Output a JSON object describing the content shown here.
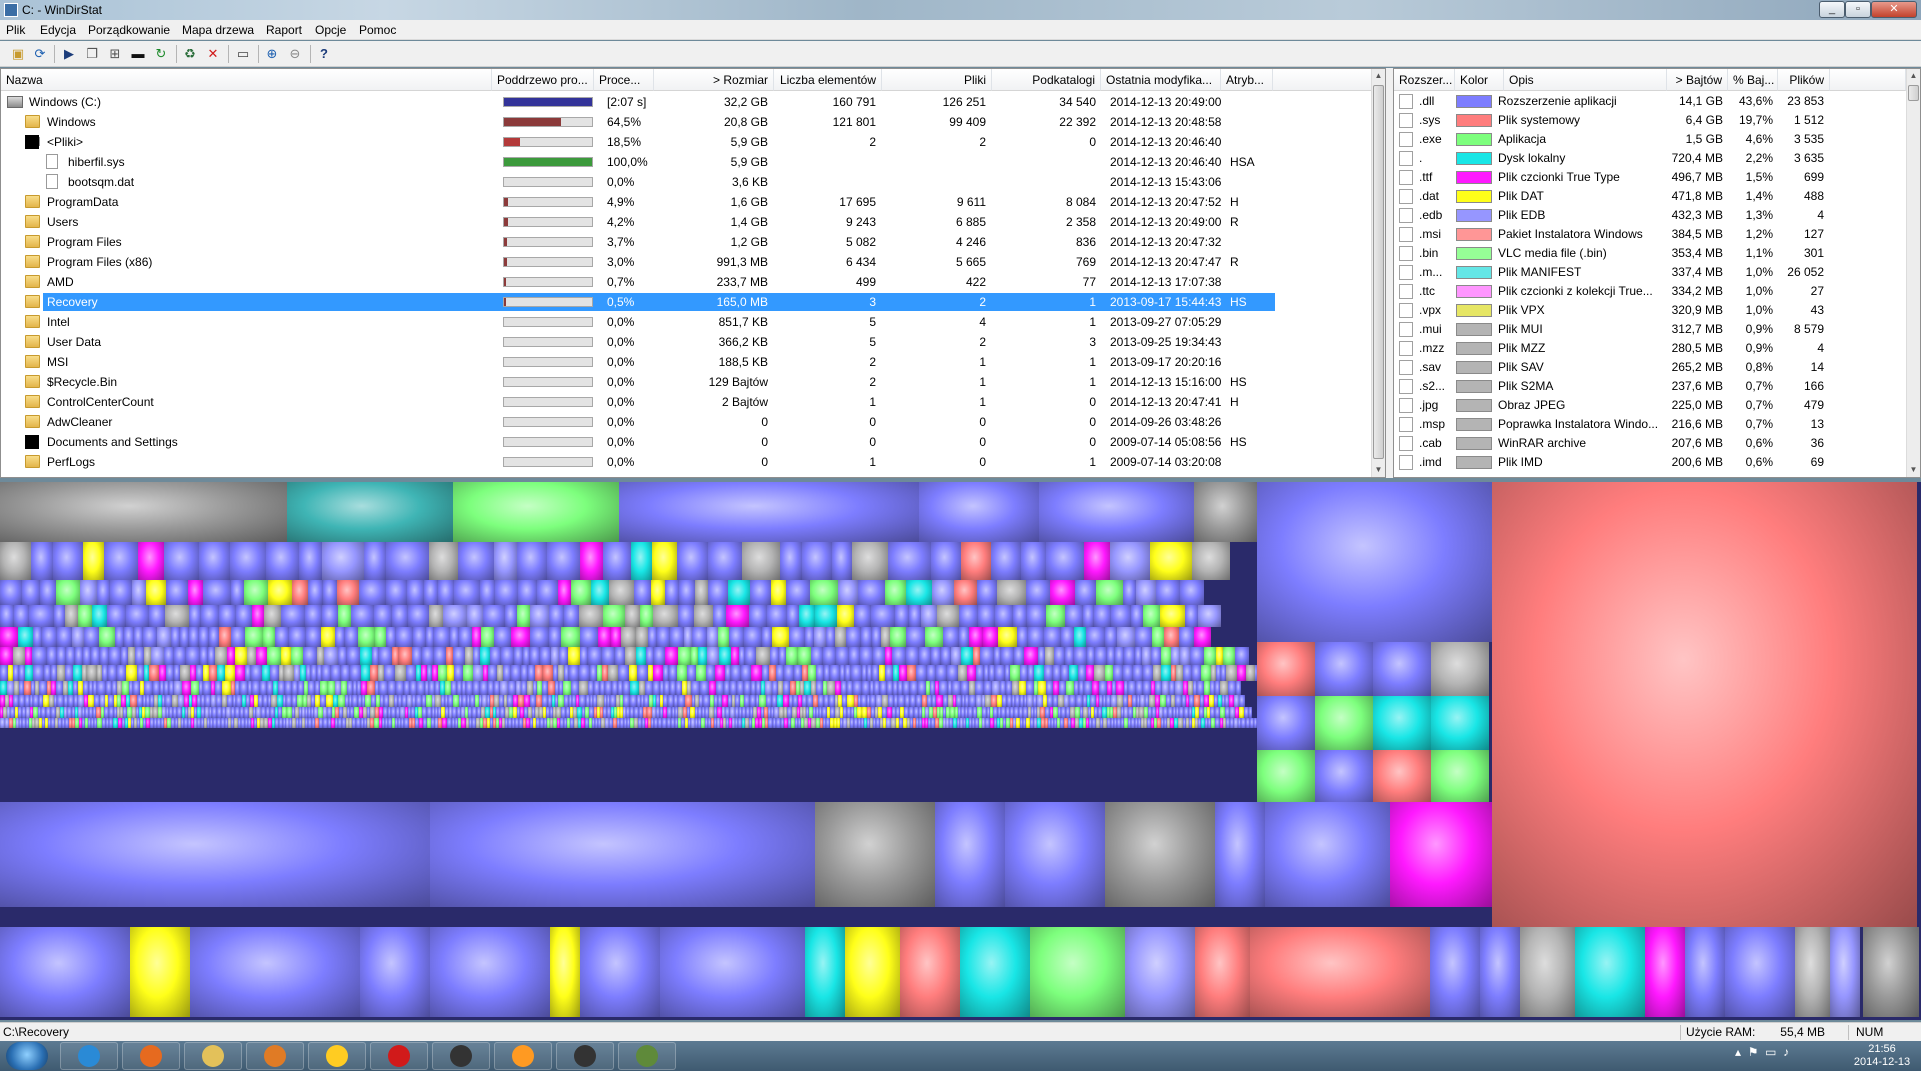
{
  "window": {
    "title": "C: - WinDirStat"
  },
  "menu": [
    "Plik",
    "Edycja",
    "Porządkowanie",
    "Mapa drzewa",
    "Raport",
    "Opcje",
    "Pomoc"
  ],
  "toolbar": [
    {
      "icon": "open-folder-icon"
    },
    {
      "icon": "refresh-selected-icon"
    },
    {
      "icon": "play-icon"
    },
    {
      "icon": "copy-path-icon"
    },
    {
      "icon": "explorer-icon"
    },
    {
      "icon": "command-prompt-icon"
    },
    {
      "icon": "refresh-icon"
    },
    {
      "icon": "recycle-icon"
    },
    {
      "icon": "delete-icon"
    },
    {
      "icon": "properties-icon"
    },
    {
      "icon": "zoom-in-icon"
    },
    {
      "icon": "zoom-out-icon"
    },
    {
      "icon": "help-icon"
    }
  ],
  "tree": {
    "columns": [
      "Nazwa",
      "Poddrzewo pro...",
      "Proce...",
      "> Rozmiar",
      "Liczba elementów",
      "Pliki",
      "Podkatalogi",
      "Ostatnia modyfika...",
      "Atryb..."
    ],
    "rows": [
      {
        "name": "Windows (C:)",
        "icon": "drive-icon",
        "indent": 0,
        "expander": "",
        "bar": 1.0,
        "bar_color": "#333399",
        "percent": "[2:07 s]",
        "size": "32,2 GB",
        "items": "160 791",
        "files": "126 251",
        "subdirs": "34 540",
        "modified": "2014-12-13  20:49:00",
        "attr": ""
      },
      {
        "name": "Windows",
        "icon": "folder-icon",
        "indent": 1,
        "expander": "+",
        "bar": 0.645,
        "bar_color": "#8b3a3a",
        "percent": "64,5%",
        "size": "20,8 GB",
        "items": "121 801",
        "files": "99 409",
        "subdirs": "22 392",
        "modified": "2014-12-13  20:48:58",
        "attr": ""
      },
      {
        "name": "<Pliki>",
        "icon": "black-icon",
        "indent": 1,
        "expander": "-",
        "bar": 0.185,
        "bar_color": "#b33a3a",
        "percent": "18,5%",
        "size": "5,9 GB",
        "items": "2",
        "files": "2",
        "subdirs": "0",
        "modified": "2014-12-13  20:46:40",
        "attr": ""
      },
      {
        "name": "hiberfil.sys",
        "icon": "file-icon",
        "indent": 2,
        "expander": "",
        "bar": 1.0,
        "bar_color": "#3c9a3c",
        "percent": "100,0%",
        "size": "5,9 GB",
        "items": "",
        "files": "",
        "subdirs": "",
        "modified": "2014-12-13  20:46:40",
        "attr": "HSA"
      },
      {
        "name": "bootsqm.dat",
        "icon": "file-icon",
        "indent": 2,
        "expander": "",
        "bar": 0.0,
        "bar_color": "#3c9a3c",
        "percent": "0,0%",
        "size": "3,6 KB",
        "items": "",
        "files": "",
        "subdirs": "",
        "modified": "2014-12-13  15:43:06",
        "attr": ""
      },
      {
        "name": "ProgramData",
        "icon": "folder-icon",
        "indent": 1,
        "expander": "+",
        "bar": 0.049,
        "bar_color": "#8b3a3a",
        "percent": "4,9%",
        "size": "1,6 GB",
        "items": "17 695",
        "files": "9 611",
        "subdirs": "8 084",
        "modified": "2014-12-13  20:47:52",
        "attr": "H"
      },
      {
        "name": "Users",
        "icon": "folder-icon",
        "indent": 1,
        "expander": "+",
        "bar": 0.042,
        "bar_color": "#8b3a3a",
        "percent": "4,2%",
        "size": "1,4 GB",
        "items": "9 243",
        "files": "6 885",
        "subdirs": "2 358",
        "modified": "2014-12-13  20:49:00",
        "attr": "R"
      },
      {
        "name": "Program Files",
        "icon": "folder-icon",
        "indent": 1,
        "expander": "+",
        "bar": 0.037,
        "bar_color": "#8b3a3a",
        "percent": "3,7%",
        "size": "1,2 GB",
        "items": "5 082",
        "files": "4 246",
        "subdirs": "836",
        "modified": "2014-12-13  20:47:32",
        "attr": ""
      },
      {
        "name": "Program Files (x86)",
        "icon": "folder-icon",
        "indent": 1,
        "expander": "+",
        "bar": 0.03,
        "bar_color": "#8b3a3a",
        "percent": "3,0%",
        "size": "991,3 MB",
        "items": "6 434",
        "files": "5 665",
        "subdirs": "769",
        "modified": "2014-12-13  20:47:47",
        "attr": "R"
      },
      {
        "name": "AMD",
        "icon": "folder-icon",
        "indent": 1,
        "expander": "+",
        "bar": 0.007,
        "bar_color": "#8b3a3a",
        "percent": "0,7%",
        "size": "233,7 MB",
        "items": "499",
        "files": "422",
        "subdirs": "77",
        "modified": "2014-12-13  17:07:38",
        "attr": ""
      },
      {
        "name": "Recovery",
        "icon": "folder-icon",
        "indent": 1,
        "expander": "+",
        "bar": 0.005,
        "bar_color": "#8b3a3a",
        "percent": "0,5%",
        "size": "165,0 MB",
        "items": "3",
        "files": "2",
        "subdirs": "1",
        "modified": "2013-09-17  15:44:43",
        "attr": "HS",
        "selected": true
      },
      {
        "name": "Intel",
        "icon": "folder-icon",
        "indent": 1,
        "expander": "+",
        "bar": 0.0,
        "bar_color": "#8b3a3a",
        "percent": "0,0%",
        "size": "851,7 KB",
        "items": "5",
        "files": "4",
        "subdirs": "1",
        "modified": "2013-09-27  07:05:29",
        "attr": ""
      },
      {
        "name": "User Data",
        "icon": "folder-icon",
        "indent": 1,
        "expander": "+",
        "bar": 0.0,
        "bar_color": "#8b3a3a",
        "percent": "0,0%",
        "size": "366,2 KB",
        "items": "5",
        "files": "2",
        "subdirs": "3",
        "modified": "2013-09-25  19:34:43",
        "attr": ""
      },
      {
        "name": "MSI",
        "icon": "folder-icon",
        "indent": 1,
        "expander": "+",
        "bar": 0.0,
        "bar_color": "#8b3a3a",
        "percent": "0,0%",
        "size": "188,5 KB",
        "items": "2",
        "files": "1",
        "subdirs": "1",
        "modified": "2013-09-17  20:20:16",
        "attr": ""
      },
      {
        "name": "$Recycle.Bin",
        "icon": "folder-icon",
        "indent": 1,
        "expander": "+",
        "bar": 0.0,
        "bar_color": "#8b3a3a",
        "percent": "0,0%",
        "size": "129 Bajtów",
        "items": "2",
        "files": "1",
        "subdirs": "1",
        "modified": "2014-12-13  15:16:00",
        "attr": "HS"
      },
      {
        "name": "ControlCenterCount",
        "icon": "folder-icon",
        "indent": 1,
        "expander": "+",
        "bar": 0.0,
        "bar_color": "#8b3a3a",
        "percent": "0,0%",
        "size": "2 Bajtów",
        "items": "1",
        "files": "1",
        "subdirs": "0",
        "modified": "2014-12-13  20:47:41",
        "attr": "H"
      },
      {
        "name": "AdwCleaner",
        "icon": "folder-icon",
        "indent": 1,
        "expander": "",
        "bar": 0.0,
        "bar_color": "#8b3a3a",
        "percent": "0,0%",
        "size": "0",
        "items": "0",
        "files": "0",
        "subdirs": "0",
        "modified": "2014-09-26  03:48:26",
        "attr": ""
      },
      {
        "name": "Documents and Settings",
        "icon": "black-icon",
        "indent": 1,
        "expander": "",
        "bar": 0.0,
        "bar_color": "#8b3a3a",
        "percent": "0,0%",
        "size": "0",
        "items": "0",
        "files": "0",
        "subdirs": "0",
        "modified": "2009-07-14  05:08:56",
        "attr": "HS"
      },
      {
        "name": "PerfLogs",
        "icon": "folder-icon",
        "indent": 1,
        "expander": "+",
        "bar": 0.0,
        "bar_color": "#8b3a3a",
        "percent": "0,0%",
        "size": "0",
        "items": "1",
        "files": "0",
        "subdirs": "1",
        "modified": "2009-07-14  03:20:08",
        "attr": ""
      }
    ]
  },
  "extensions": {
    "columns": [
      "Rozszer...",
      "Kolor",
      "Opis",
      "> Bajtów",
      "% Baj...",
      "Plików"
    ],
    "rows": [
      {
        "ext": ".dll",
        "color": "#7d7dff",
        "desc": "Rozszerzenie aplikacji",
        "bytes": "14,1 GB",
        "pct": "43,6%",
        "files": "23 853"
      },
      {
        "ext": ".sys",
        "color": "#ff7d7d",
        "desc": "Plik systemowy",
        "bytes": "6,4 GB",
        "pct": "19,7%",
        "files": "1 512"
      },
      {
        "ext": ".exe",
        "color": "#7dff7d",
        "desc": "Aplikacja",
        "bytes": "1,5 GB",
        "pct": "4,6%",
        "files": "3 535"
      },
      {
        "ext": ".",
        "color": "#19e6e6",
        "desc": "Dysk lokalny",
        "bytes": "720,4 MB",
        "pct": "2,2%",
        "files": "3 635"
      },
      {
        "ext": ".ttf",
        "color": "#ff19ff",
        "desc": "Plik czcionki True Type",
        "bytes": "496,7 MB",
        "pct": "1,5%",
        "files": "699"
      },
      {
        "ext": ".dat",
        "color": "#ffff19",
        "desc": "Plik DAT",
        "bytes": "471,8 MB",
        "pct": "1,4%",
        "files": "488"
      },
      {
        "ext": ".edb",
        "color": "#9696ff",
        "desc": "Plik EDB",
        "bytes": "432,3 MB",
        "pct": "1,3%",
        "files": "4"
      },
      {
        "ext": ".msi",
        "color": "#ff9696",
        "desc": "Pakiet Instalatora Windows",
        "bytes": "384,5 MB",
        "pct": "1,2%",
        "files": "127"
      },
      {
        "ext": ".bin",
        "color": "#96ff96",
        "desc": "VLC media file (.bin)",
        "bytes": "353,4 MB",
        "pct": "1,1%",
        "files": "301"
      },
      {
        "ext": ".m...",
        "color": "#64e6e6",
        "desc": "Plik MANIFEST",
        "bytes": "337,4 MB",
        "pct": "1,0%",
        "files": "26 052"
      },
      {
        "ext": ".ttc",
        "color": "#ff96ff",
        "desc": "Plik czcionki z kolekcji True...",
        "bytes": "334,2 MB",
        "pct": "1,0%",
        "files": "27"
      },
      {
        "ext": ".vpx",
        "color": "#e6e664",
        "desc": "Plik VPX",
        "bytes": "320,9 MB",
        "pct": "1,0%",
        "files": "43"
      },
      {
        "ext": ".mui",
        "color": "#b4b4b4",
        "desc": "Plik MUI",
        "bytes": "312,7 MB",
        "pct": "0,9%",
        "files": "8 579"
      },
      {
        "ext": ".mzz",
        "color": "#b4b4b4",
        "desc": "Plik MZZ",
        "bytes": "280,5 MB",
        "pct": "0,9%",
        "files": "4"
      },
      {
        "ext": ".sav",
        "color": "#b4b4b4",
        "desc": "Plik SAV",
        "bytes": "265,2 MB",
        "pct": "0,8%",
        "files": "14"
      },
      {
        "ext": ".s2...",
        "color": "#b4b4b4",
        "desc": "Plik S2MA",
        "bytes": "237,6 MB",
        "pct": "0,7%",
        "files": "166"
      },
      {
        "ext": ".jpg",
        "color": "#b4b4b4",
        "desc": "Obraz JPEG",
        "bytes": "225,0 MB",
        "pct": "0,7%",
        "files": "479"
      },
      {
        "ext": ".msp",
        "color": "#b4b4b4",
        "desc": "Poprawka Instalatora Windo...",
        "bytes": "216,6 MB",
        "pct": "0,7%",
        "files": "13"
      },
      {
        "ext": ".cab",
        "color": "#b4b4b4",
        "desc": "WinRAR archive",
        "bytes": "207,6 MB",
        "pct": "0,6%",
        "files": "36"
      },
      {
        "ext": ".imd",
        "color": "#b4b4b4",
        "desc": "Plik IMD",
        "bytes": "200,6 MB",
        "pct": "0,6%",
        "files": "69"
      }
    ]
  },
  "status": {
    "path": "C:\\Recovery",
    "ram_label": "Użycie RAM:",
    "ram_value": "55,4 MB",
    "num": "NUM"
  },
  "taskbar": {
    "apps": [
      {
        "icon": "internet-explorer-icon",
        "color": "#2a8ad6"
      },
      {
        "icon": "firefox-icon",
        "color": "#e66a1f"
      },
      {
        "icon": "file-explorer-icon",
        "color": "#e3c15a"
      },
      {
        "icon": "media-player-icon",
        "color": "#e07b25"
      },
      {
        "icon": "sun-app-icon",
        "color": "#ffcc22"
      },
      {
        "icon": "opera-icon",
        "color": "#d11a1a"
      },
      {
        "icon": "msi-afterburner-icon",
        "color": "#333333"
      },
      {
        "icon": "weather-app-icon",
        "color": "#ff9a22"
      },
      {
        "icon": "msi-app-icon",
        "color": "#333333"
      },
      {
        "icon": "windirstat-icon",
        "color": "#5f8a3a"
      }
    ],
    "clock_time": "21:56",
    "clock_date": "2014-12-13"
  }
}
